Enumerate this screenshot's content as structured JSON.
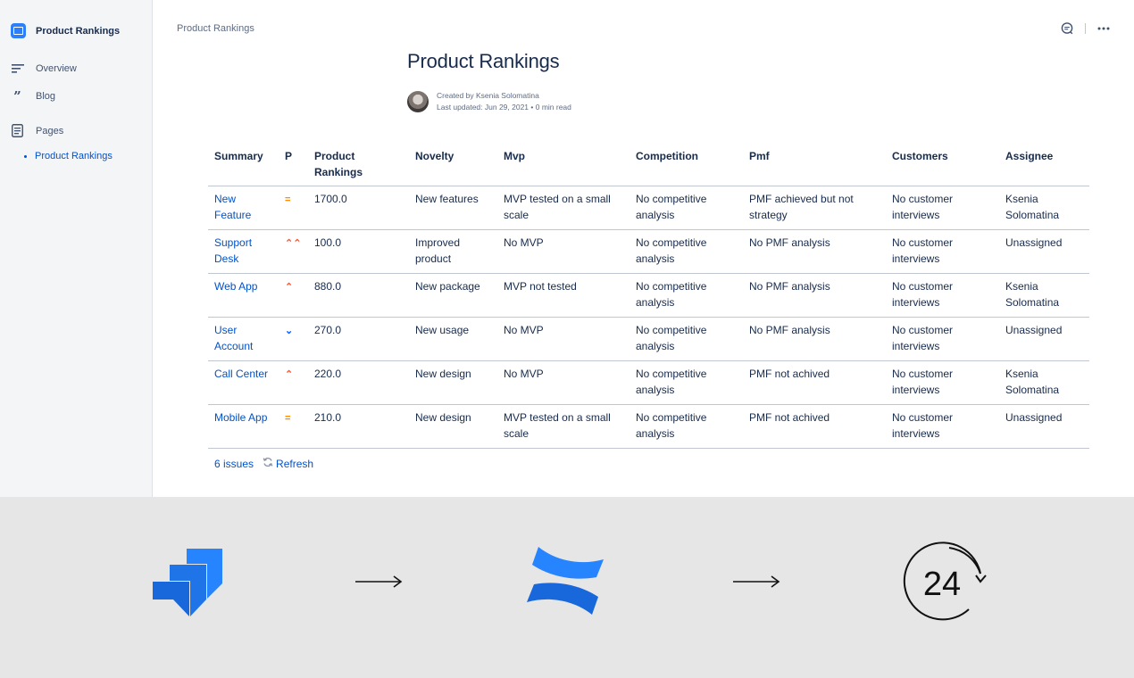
{
  "sidebar": {
    "space_name": "Product Rankings",
    "items": [
      {
        "label": "Overview",
        "icon": "overview-lines-icon"
      },
      {
        "label": "Blog",
        "icon": "quote-icon"
      },
      {
        "label": "Pages",
        "icon": "page-icon"
      }
    ],
    "subitem": "Product Rankings"
  },
  "breadcrumb": "Product Rankings",
  "page": {
    "title": "Product Rankings",
    "created_by": "Created by Ksenia Solomatina",
    "last_updated": "Last updated: Jun 29, 2021 •   0 min read"
  },
  "table": {
    "headers": [
      "Summary",
      "P",
      "Product Rankings",
      "Novelty",
      "Mvp",
      "Competition",
      "Pmf",
      "Customers",
      "Assignee"
    ],
    "rows": [
      {
        "summary": "New Feature",
        "priority": "=",
        "priority_name": "medium",
        "ranking": "1700.0",
        "novelty": "New features",
        "mvp": "MVP tested on a small scale",
        "competition": "No competitive analysis",
        "pmf": "PMF achieved but not strategy",
        "customers": "No customer interviews",
        "assignee": "Ksenia Solomatina"
      },
      {
        "summary": "Support Desk",
        "priority": "⌃⌃",
        "priority_name": "highest",
        "ranking": "100.0",
        "novelty": "Improved product",
        "mvp": "No MVP",
        "competition": "No competitive analysis",
        "pmf": "No PMF analysis",
        "customers": "No customer interviews",
        "assignee": "Unassigned"
      },
      {
        "summary": "Web App",
        "priority": "⌃",
        "priority_name": "high",
        "ranking": "880.0",
        "novelty": "New package",
        "mvp": "MVP not tested",
        "competition": "No competitive analysis",
        "pmf": "No PMF analysis",
        "customers": "No customer interviews",
        "assignee": "Ksenia Solomatina"
      },
      {
        "summary": "User Account",
        "priority": "⌄",
        "priority_name": "low",
        "ranking": "270.0",
        "novelty": "New usage",
        "mvp": "No MVP",
        "competition": "No competitive analysis",
        "pmf": "No PMF analysis",
        "customers": "No customer interviews",
        "assignee": "Unassigned"
      },
      {
        "summary": "Call Center",
        "priority": "⌃",
        "priority_name": "high",
        "ranking": "220.0",
        "novelty": "New design",
        "mvp": "No MVP",
        "competition": "No competitive analysis",
        "pmf": "PMF not achived",
        "customers": "No customer interviews",
        "assignee": "Ksenia Solomatina"
      },
      {
        "summary": "Mobile App",
        "priority": "=",
        "priority_name": "medium",
        "ranking": "210.0",
        "novelty": "New design",
        "mvp": "MVP tested on a small scale",
        "competition": "No competitive analysis",
        "pmf": "PMF not achived",
        "customers": "No customer interviews",
        "assignee": "Unassigned"
      }
    ]
  },
  "footer": {
    "issues_count": "6 issues",
    "refresh_label": "Refresh"
  },
  "flow": {
    "clock_label": "24"
  },
  "colors": {
    "link": "#0052cc",
    "priority_medium": "#ff8b00",
    "priority_high": "#ff5630",
    "priority_low": "#0065ff",
    "jira_blue": "#2684ff",
    "confluence_blue": "#1868db"
  }
}
